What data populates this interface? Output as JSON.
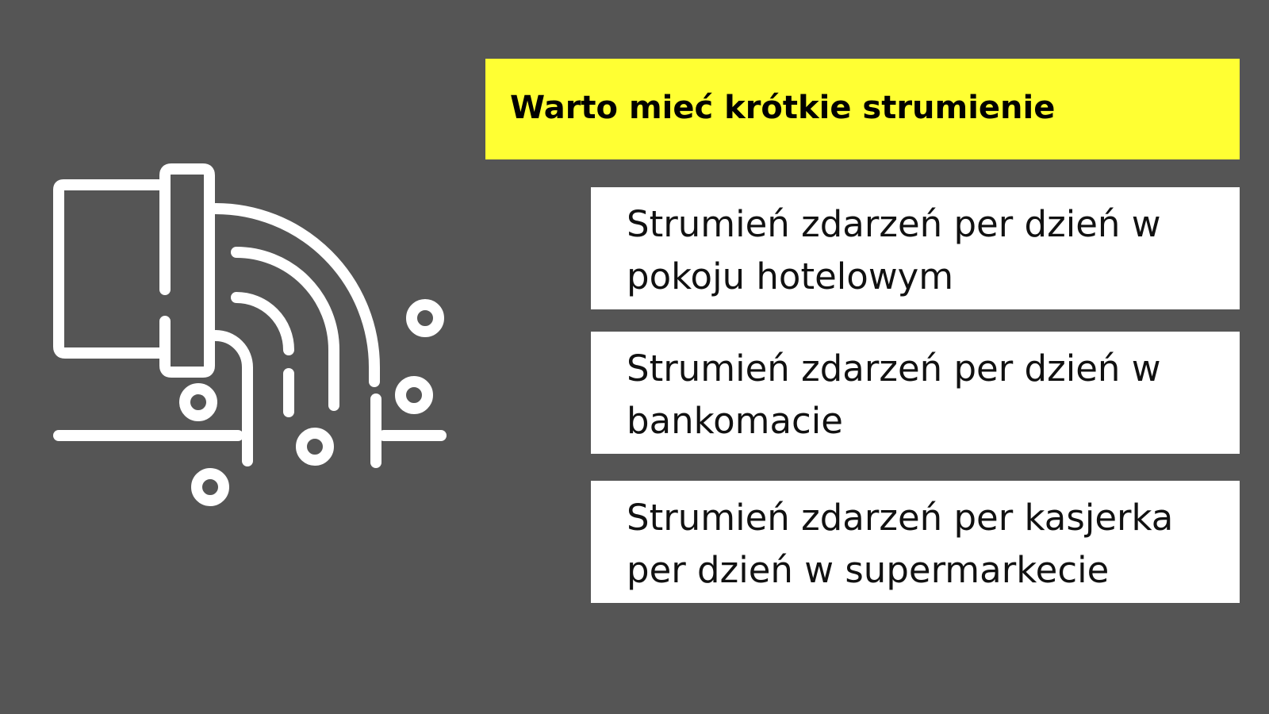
{
  "title": "Warto mieć krótkie strumienie",
  "items": [
    {
      "text": "Strumień zdarzeń per dzień w pokoju hotelowym"
    },
    {
      "text": "Strumień zdarzeń per dzień w bankomacie"
    },
    {
      "text": "Strumień zdarzeń per kasjerka per dzień w supermarkecie"
    }
  ],
  "icon": {
    "name": "data-stream-pipe-icon",
    "color": "#ffffff"
  },
  "colors": {
    "background": "#555555",
    "title_background": "#ffff33",
    "item_background": "#ffffff",
    "title_text": "#000000",
    "item_text": "#111111"
  }
}
